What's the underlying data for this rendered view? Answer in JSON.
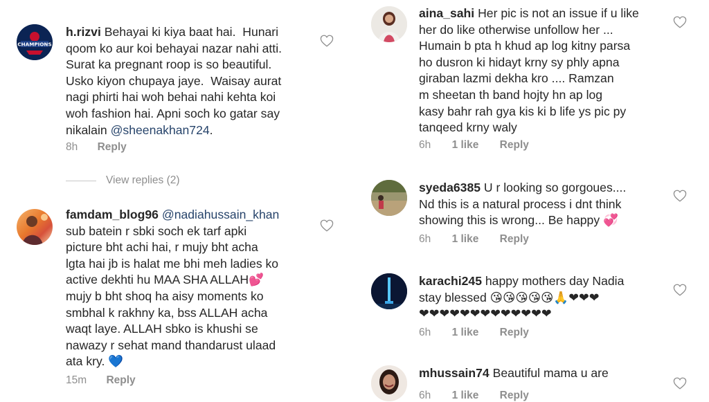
{
  "left": {
    "c1": {
      "username": "h.rizvi",
      "lines": [
        " Behayai ki kiya baat hai.  Hunari",
        "qoom ko aur koi behayai nazar nahi atti.",
        "Surat ka pregnant roop is so beautiful.",
        "Usko kiyon chupaya jaye.  Waisay aurat",
        "nagi phirti hai woh behai nahi kehta koi",
        "woh fashion hai. Apni soch ko gatar say",
        "nikalain "
      ],
      "mention": "@sheenakhan724",
      "tail": ".",
      "time": "8h",
      "reply": "Reply",
      "avatar_badge": "CHAMPIONS"
    },
    "view_replies": "View replies (2)",
    "c2": {
      "username": "famdam_blog96",
      "mention": "@nadiahussain_khan",
      "lines": [
        "sub batein r sbki soch ek tarf apki",
        "picture bht achi hai, r mujy bht acha",
        "lgta hai jb is halat me bhi meh ladies ko",
        "active dekhti hu MAA SHA ALLAH💕",
        "mujy b bht shoq ha aisy moments ko",
        "smbhal k rakhny ka, bss ALLAH acha",
        "waqt laye. ALLAH sbko is khushi se",
        "nawazy r sehat mand thandarust ulaad",
        "ata kry. 💙"
      ],
      "time": "15m",
      "reply": "Reply"
    }
  },
  "right": {
    "c1": {
      "username": "aina_sahi",
      "lines": [
        " Her pic is not an issue if u like",
        "her do like otherwise unfollow her ...",
        "Humain b pta h khud ap log kitny parsa",
        "ho dusron ki hidayt krny sy phly apna",
        "giraban lazmi dekha kro .... Ramzan",
        "m sheetan th band hojty hn ap log",
        "kasy bahr rah gya kis ki b life ys pic py",
        "tanqeed krny waly"
      ],
      "time": "6h",
      "likes": "1 like",
      "reply": "Reply"
    },
    "c2": {
      "username": "syeda6385",
      "lines": [
        " U r looking so gorgoues....",
        "Nd this is a natural process i dnt think",
        "showing this is wrong... Be happy 💞"
      ],
      "time": "6h",
      "likes": "1 like",
      "reply": "Reply"
    },
    "c3": {
      "username": "karachi245",
      "lines": [
        " happy mothers day Nadia",
        "stay blessed 😘😘😘😘😘🙏❤❤❤",
        "❤❤❤❤❤❤❤❤❤❤❤❤❤"
      ],
      "time": "6h",
      "likes": "1 like",
      "reply": "Reply"
    },
    "c4": {
      "username": "mhussain74",
      "lines": [
        " Beautiful mama u are"
      ],
      "time": "6h",
      "likes": "1 like",
      "reply": "Reply"
    }
  },
  "colors": {
    "text": "#262626",
    "muted": "#8e8e8e",
    "mention": "#27446b",
    "emoji_heart": "#e0242b"
  },
  "icons": [
    "heart-outline-icon"
  ]
}
